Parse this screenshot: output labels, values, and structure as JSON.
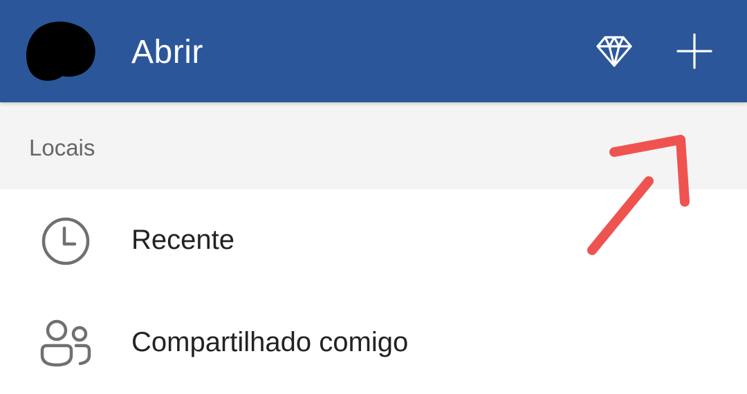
{
  "app_bar": {
    "title": "Abrir",
    "background_color": "#2b579a",
    "avatar": "redacted-avatar",
    "actions": [
      {
        "icon": "diamond-icon",
        "name": "premium-button"
      },
      {
        "icon": "plus-icon",
        "name": "new-document-button"
      }
    ]
  },
  "locations": {
    "header": "Locais",
    "items": [
      {
        "label": "Recente",
        "icon": "clock-icon"
      },
      {
        "label": "Compartilhado comigo",
        "icon": "people-icon"
      }
    ]
  },
  "annotation": {
    "type": "arrow",
    "color": "#ef5350",
    "points_to": "new-document-button"
  }
}
